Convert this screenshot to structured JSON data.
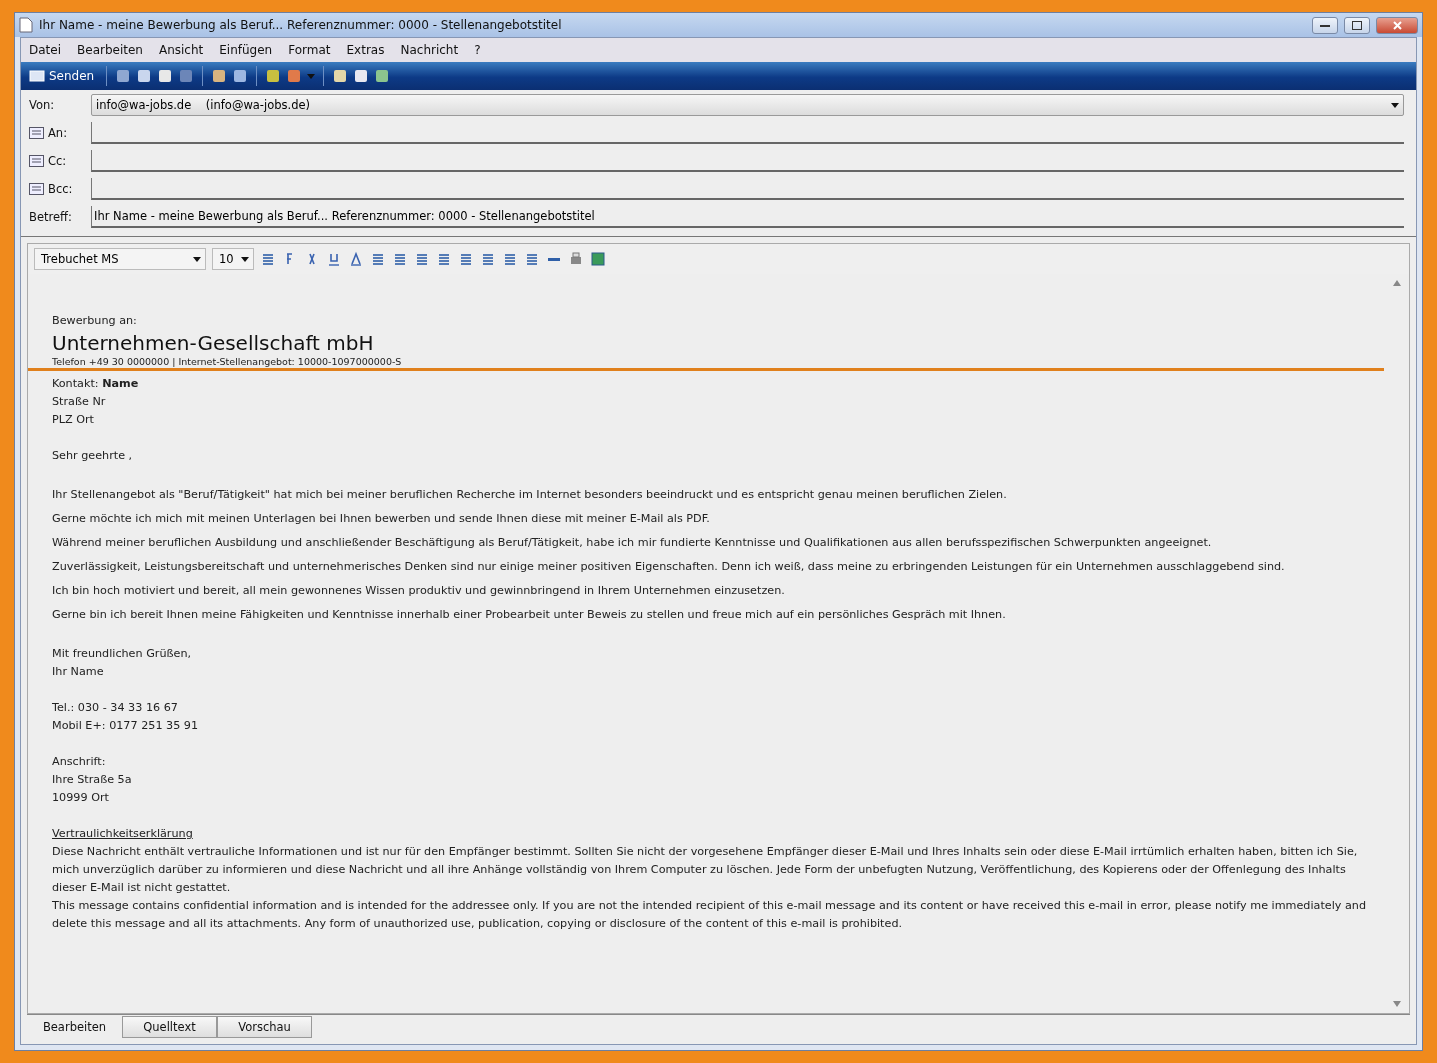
{
  "window": {
    "title": "Ihr Name - meine Bewerbung als Beruf... Referenznummer: 0000 - Stellenangebotstitel"
  },
  "menu": [
    "Datei",
    "Bearbeiten",
    "Ansicht",
    "Einfügen",
    "Format",
    "Extras",
    "Nachricht",
    "?"
  ],
  "toolbar": {
    "send_label": "Senden"
  },
  "header": {
    "from": {
      "label": "Von:",
      "value": "info@wa-jobs.de    (info@wa-jobs.de)"
    },
    "recipients": [
      {
        "label": "An:"
      },
      {
        "label": "Cc:"
      },
      {
        "label": "Bcc:"
      }
    ],
    "subject": {
      "label": "Betreff:",
      "value": "Ihr Name - meine Bewerbung als Beruf... Referenznummer: 0000 - Stellenangebotstitel"
    }
  },
  "format_bar": {
    "font": "Trebuchet MS",
    "size": "10"
  },
  "body": {
    "recipient_label": "Bewerbung an:",
    "company": "Unternehmen-Gesellschaft mbH",
    "company_info": "Telefon +49 30 0000000 | Internet-Stellenangebot: 10000-1097000000-S",
    "contact": [
      "Kontakt: **Name**",
      "Straße Nr",
      "PLZ Ort"
    ],
    "greeting": "Sehr geehrte ,",
    "paragraphs": [
      "Ihr Stellenangebot als \"Beruf/Tätigkeit\" hat mich bei meiner beruflichen Recherche im Internet besonders beeindruckt und es entspricht genau meinen beruflichen Zielen.",
      "Gerne möchte ich mich mit meinen Unterlagen bei Ihnen bewerben und sende Ihnen diese mit meiner E-Mail als PDF.",
      "Während meiner beruflichen Ausbildung und anschließender Beschäftigung als Beruf/Tätigkeit, habe ich mir fundierte Kenntnisse und Qualifikationen aus allen berufsspezifischen Schwerpunkten angeeignet.",
      "Zuverlässigkeit, Leistungsbereitschaft und unternehmerisches Denken sind nur einige meiner positiven Eigenschaften. Denn ich weiß, dass meine zu erbringenden Leistungen für ein Unternehmen ausschlaggebend sind.",
      "Ich bin hoch motiviert und bereit, all mein gewonnenes Wissen produktiv und gewinnbringend in Ihrem Unternehmen einzusetzen.",
      "Gerne bin ich bereit Ihnen meine Fähigkeiten und Kenntnisse innerhalb einer Probearbeit unter Beweis zu stellen und freue mich auf ein persönliches Gespräch mit Ihnen."
    ],
    "closing": [
      "Mit freundlichen Grüßen,",
      "Ihr Name"
    ],
    "phones": [
      "Tel.: 030 - 34 33 16 67",
      "Mobil E+: 0177 251 35 91"
    ],
    "address": [
      "Anschrift:",
      "Ihre Straße 5a",
      "10999 Ort"
    ],
    "disclaimer_title": "Vertraulichkeitserklärung",
    "disclaimer": [
      "Diese Nachricht enthält vertrauliche Informationen und ist nur für den Empfänger bestimmt. Sollten Sie nicht der vorgesehene Empfänger dieser E-Mail und Ihres Inhalts sein oder diese E-Mail irrtümlich erhalten haben, bitten ich Sie, mich unverzüglich darüber zu informieren und diese Nachricht und all ihre Anhänge vollständig von Ihrem Computer zu löschen. Jede Form der unbefugten Nutzung, Veröffentlichung, des Kopierens oder der Offenlegung des Inhalts dieser E-Mail ist nicht gestattet.",
      "This message contains confidential information and is intended for the addressee only. If you are not the intended recipient of this e-mail message and its content or have received this e-mail in error, please notify me immediately and delete this message and all its attachments. Any form of unauthorized use, publication, copying or disclosure of the content of this e-mail is prohibited."
    ]
  },
  "view_tabs": [
    {
      "label": "Bearbeiten",
      "selected": true
    },
    {
      "label": "Quelltext",
      "selected": false
    },
    {
      "label": "Vorschau",
      "selected": false
    }
  ]
}
